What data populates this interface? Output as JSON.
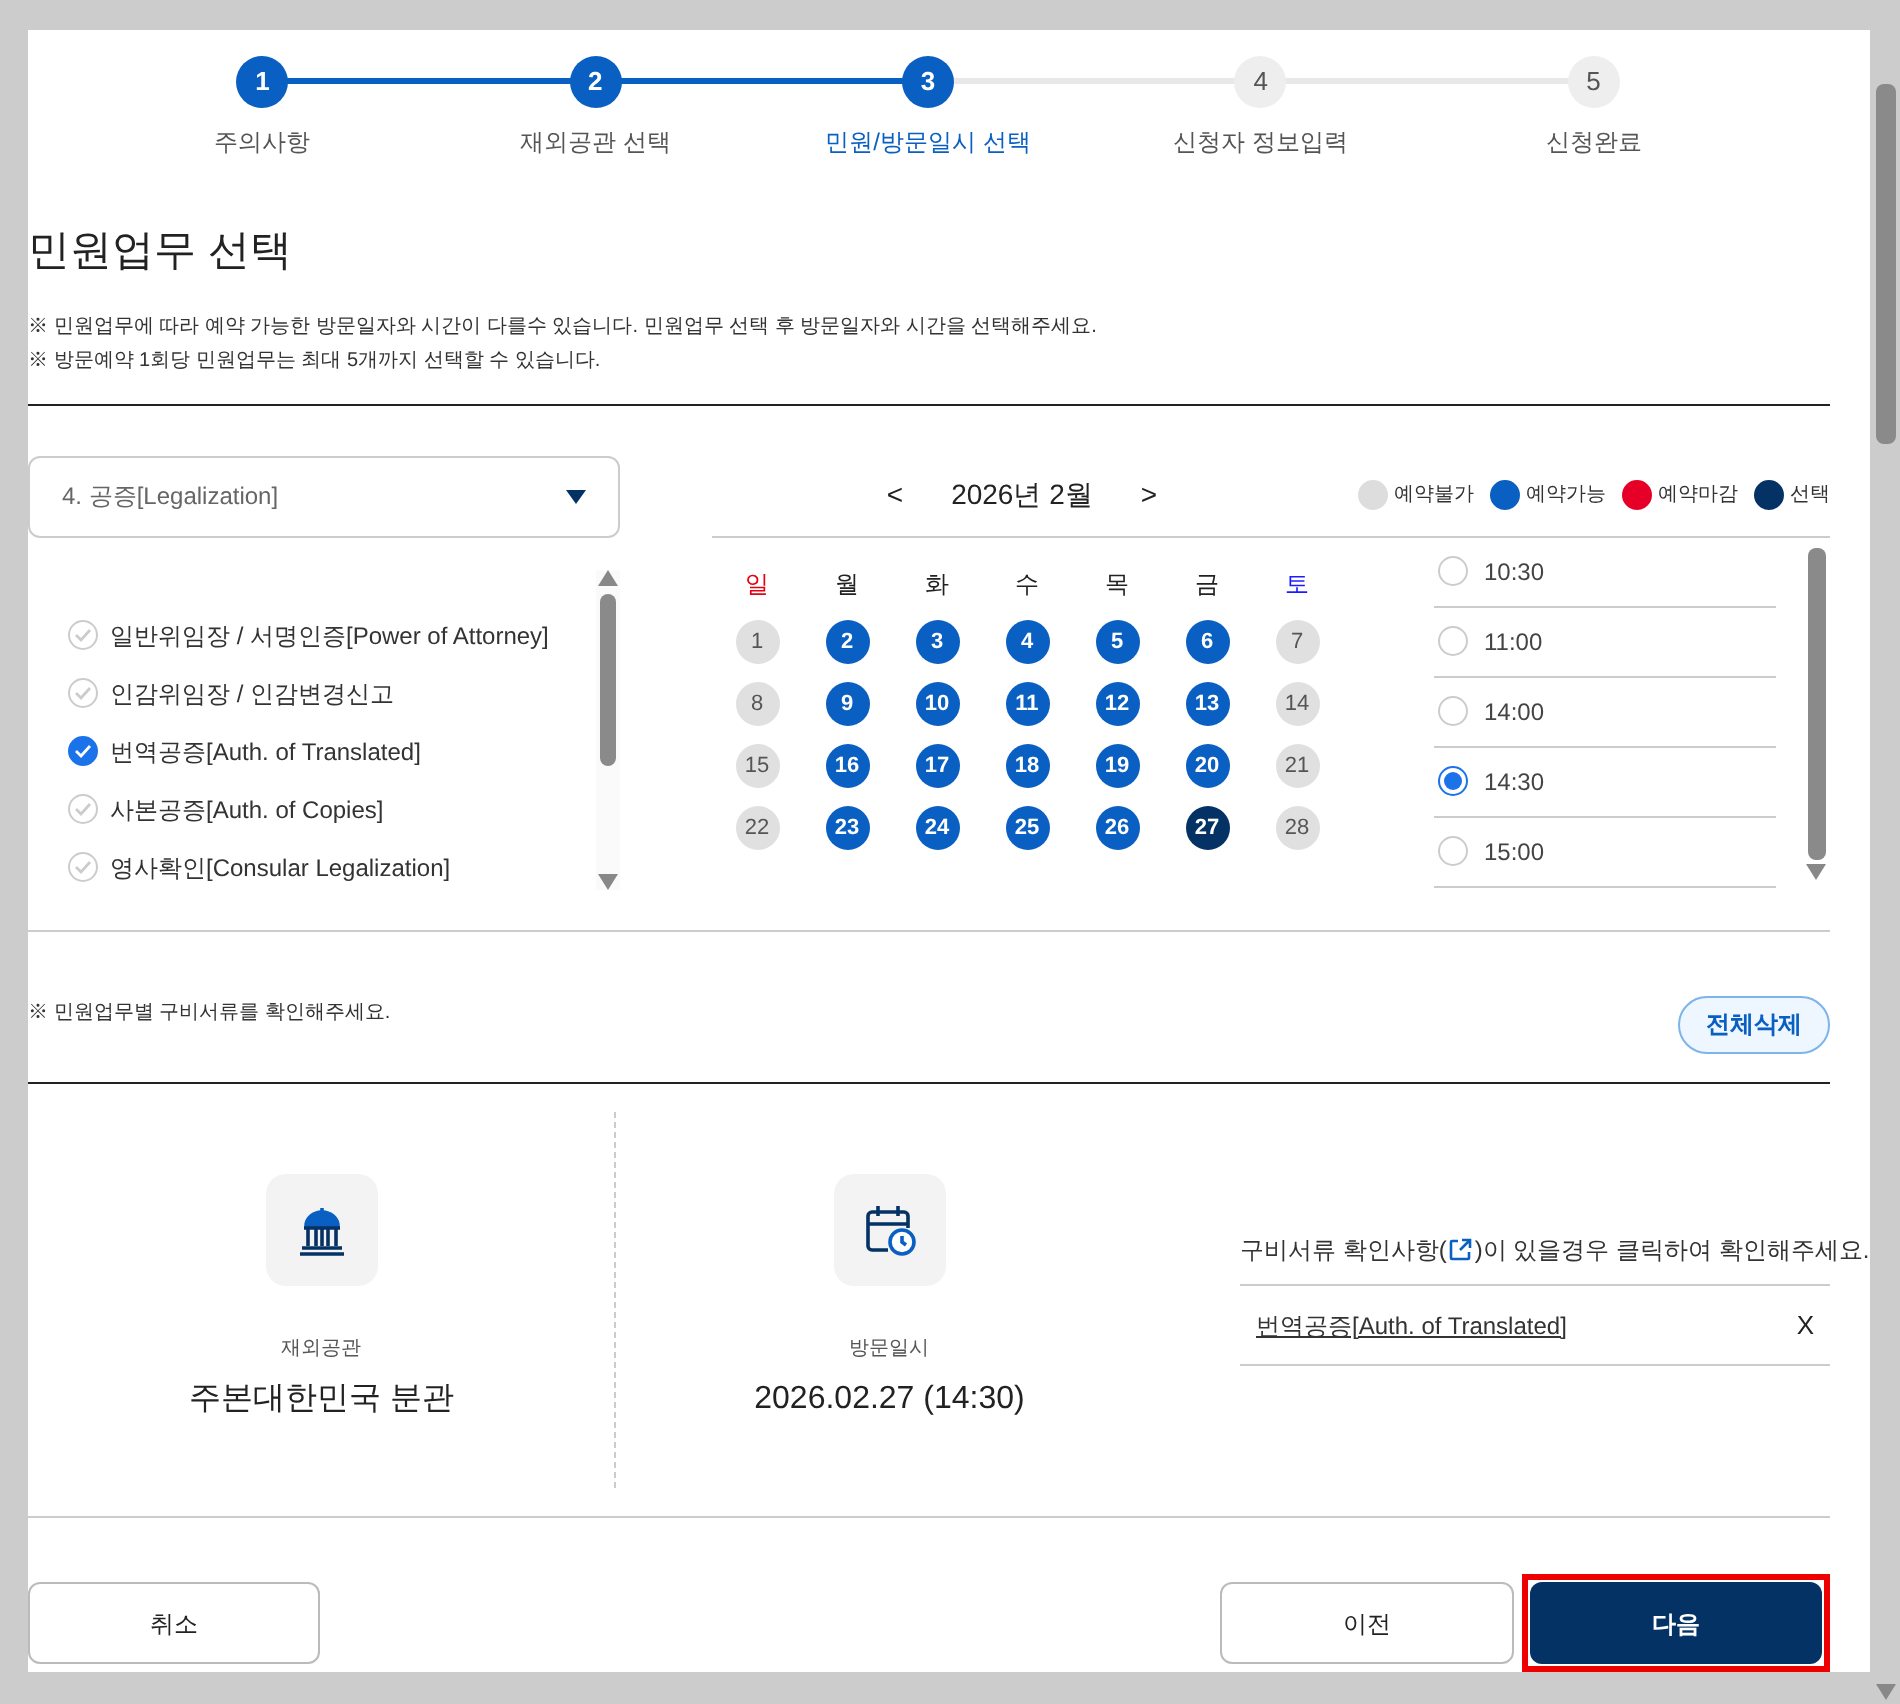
{
  "steps": [
    {
      "number": "1",
      "label": "주의사항",
      "done": true,
      "selected": false
    },
    {
      "number": "2",
      "label": "재외공관 선택",
      "done": true,
      "selected": false
    },
    {
      "number": "3",
      "label": "민원/방문일시 선택",
      "done": true,
      "selected": true
    },
    {
      "number": "4",
      "label": "신청자 정보입력",
      "done": false,
      "selected": false
    },
    {
      "number": "5",
      "label": "신청완료",
      "done": false,
      "selected": false
    }
  ],
  "heading": "민원업무 선택",
  "notes": [
    "※ 민원업무에 따라 예약 가능한 방문일자와 시간이 다를수 있습니다. 민원업무 선택 후 방문일자와 시간을 선택해주세요.",
    "※ 방문예약 1회당 민원업무는 최대 5개까지 선택할 수 있습니다."
  ],
  "category_select": {
    "value": "4. 공증[Legalization]"
  },
  "services": [
    {
      "label": "일반위임장 / 서명인증[Power of Attorney]",
      "checked": false
    },
    {
      "label": "인감위임장 / 인감변경신고",
      "checked": false
    },
    {
      "label": "번역공증[Auth. of Translated]",
      "checked": true
    },
    {
      "label": "사본공증[Auth. of Copies]",
      "checked": false
    },
    {
      "label": "영사확인[Consular Legalization]",
      "checked": false
    }
  ],
  "calendar": {
    "prev": "<",
    "month": "2026년 2월",
    "next": ">",
    "legend": [
      {
        "label": "예약불가",
        "color": "#dddddd"
      },
      {
        "label": "예약가능",
        "color": "#0a5fc2"
      },
      {
        "label": "예약마감",
        "color": "#e60028"
      },
      {
        "label": "선택",
        "color": "#053264"
      }
    ],
    "weekdays": [
      {
        "label": "일",
        "color": "#e60012"
      },
      {
        "label": "월",
        "color": "#222222"
      },
      {
        "label": "화",
        "color": "#222222"
      },
      {
        "label": "수",
        "color": "#222222"
      },
      {
        "label": "목",
        "color": "#222222"
      },
      {
        "label": "금",
        "color": "#222222"
      },
      {
        "label": "토",
        "color": "#1a1aff"
      }
    ],
    "days": [
      {
        "label": "1",
        "available": false,
        "selected": false
      },
      {
        "label": "2",
        "available": true,
        "selected": false
      },
      {
        "label": "3",
        "available": true,
        "selected": false
      },
      {
        "label": "4",
        "available": true,
        "selected": false
      },
      {
        "label": "5",
        "available": true,
        "selected": false
      },
      {
        "label": "6",
        "available": true,
        "selected": false
      },
      {
        "label": "7",
        "available": false,
        "selected": false
      },
      {
        "label": "8",
        "available": false,
        "selected": false
      },
      {
        "label": "9",
        "available": true,
        "selected": false
      },
      {
        "label": "10",
        "available": true,
        "selected": false
      },
      {
        "label": "11",
        "available": true,
        "selected": false
      },
      {
        "label": "12",
        "available": true,
        "selected": false
      },
      {
        "label": "13",
        "available": true,
        "selected": false
      },
      {
        "label": "14",
        "available": false,
        "selected": false
      },
      {
        "label": "15",
        "available": false,
        "selected": false
      },
      {
        "label": "16",
        "available": true,
        "selected": false
      },
      {
        "label": "17",
        "available": true,
        "selected": false
      },
      {
        "label": "18",
        "available": true,
        "selected": false
      },
      {
        "label": "19",
        "available": true,
        "selected": false
      },
      {
        "label": "20",
        "available": true,
        "selected": false
      },
      {
        "label": "21",
        "available": false,
        "selected": false
      },
      {
        "label": "22",
        "available": false,
        "selected": false
      },
      {
        "label": "23",
        "available": true,
        "selected": false
      },
      {
        "label": "24",
        "available": true,
        "selected": false
      },
      {
        "label": "25",
        "available": true,
        "selected": false
      },
      {
        "label": "26",
        "available": true,
        "selected": false
      },
      {
        "label": "27",
        "available": true,
        "selected": true
      },
      {
        "label": "28",
        "available": false,
        "selected": false
      }
    ]
  },
  "times": [
    {
      "label": "10:30",
      "selected": false
    },
    {
      "label": "11:00",
      "selected": false
    },
    {
      "label": "14:00",
      "selected": false
    },
    {
      "label": "14:30",
      "selected": true
    },
    {
      "label": "15:00",
      "selected": false
    }
  ],
  "documents_note": "※ 민원업무별 구비서류를 확인해주세요.",
  "clear_all_button": "전체삭제",
  "summary": {
    "office_label": "재외공관",
    "office": "주본대한민국 분관",
    "date_label": "방문일시",
    "date": "2026.02.27 (14:30)",
    "hint_start": "구비서류 확인사항(",
    "hint_end": ")이 있을경우 클릭하여 확인해주세요.",
    "documents": [
      {
        "label": "번역공증[Auth. of Translated]",
        "remove": "X"
      }
    ]
  },
  "buttons": {
    "cancel": "취소",
    "prev": "이전",
    "next": "다음"
  }
}
